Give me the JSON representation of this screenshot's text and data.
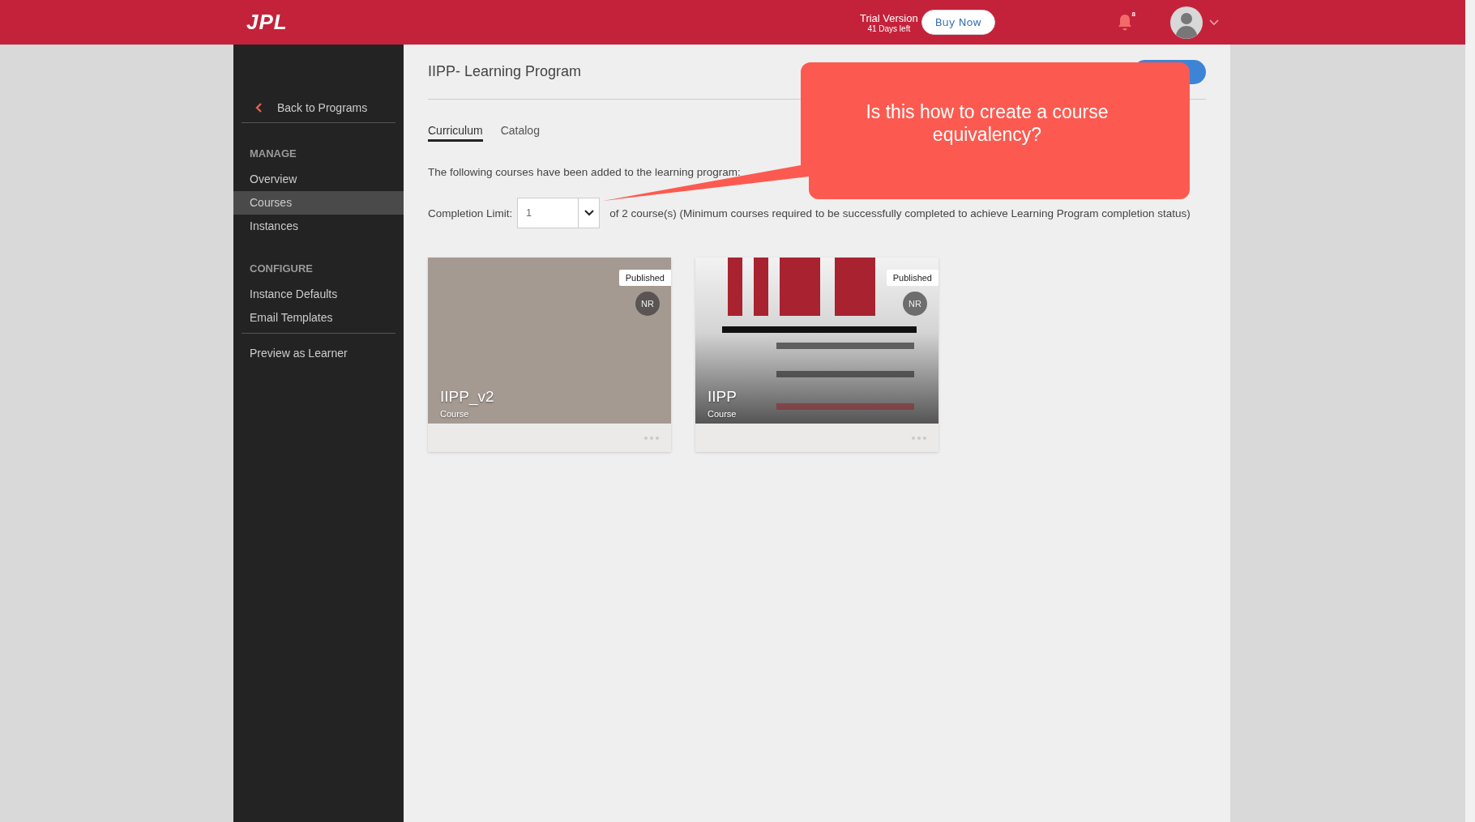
{
  "header": {
    "logo": "JPL",
    "trial": {
      "title": "Trial Version",
      "subtitle": "41 Days left"
    },
    "buy_button": "Buy Now",
    "notification_count": "8"
  },
  "sidebar": {
    "back_link": "Back to Programs",
    "sections": [
      {
        "heading": "MANAGE",
        "items": [
          {
            "label": "Overview",
            "selected": false
          },
          {
            "label": "Courses",
            "selected": true
          },
          {
            "label": "Instances",
            "selected": false
          }
        ]
      },
      {
        "heading": "CONFIGURE",
        "items": [
          {
            "label": "Instance Defaults",
            "selected": false
          },
          {
            "label": "Email Templates",
            "selected": false
          }
        ]
      }
    ],
    "footer_items": [
      "Preview as Learner"
    ]
  },
  "main": {
    "title": "IIPP- Learning Program",
    "tabs": [
      {
        "label": "Curriculum",
        "selected": true
      },
      {
        "label": "Catalog",
        "selected": false
      }
    ],
    "intro": "The following courses have been added to the learning program:",
    "completion": {
      "label": "Completion Limit:",
      "value": "1",
      "note": "of 2 course(s) (Minimum courses required to be successfully completed to achieve Learning Program completion status)"
    },
    "cards": [
      {
        "kind": "plain",
        "title": "IIPP_v2",
        "type": "Course",
        "status": "Published",
        "initials": "NR"
      },
      {
        "kind": "picture",
        "title": "IIPP",
        "type": "Course",
        "status": "Published",
        "initials": "NR"
      }
    ]
  },
  "callout": {
    "text": "Is this how to create a course equivalency?"
  }
}
